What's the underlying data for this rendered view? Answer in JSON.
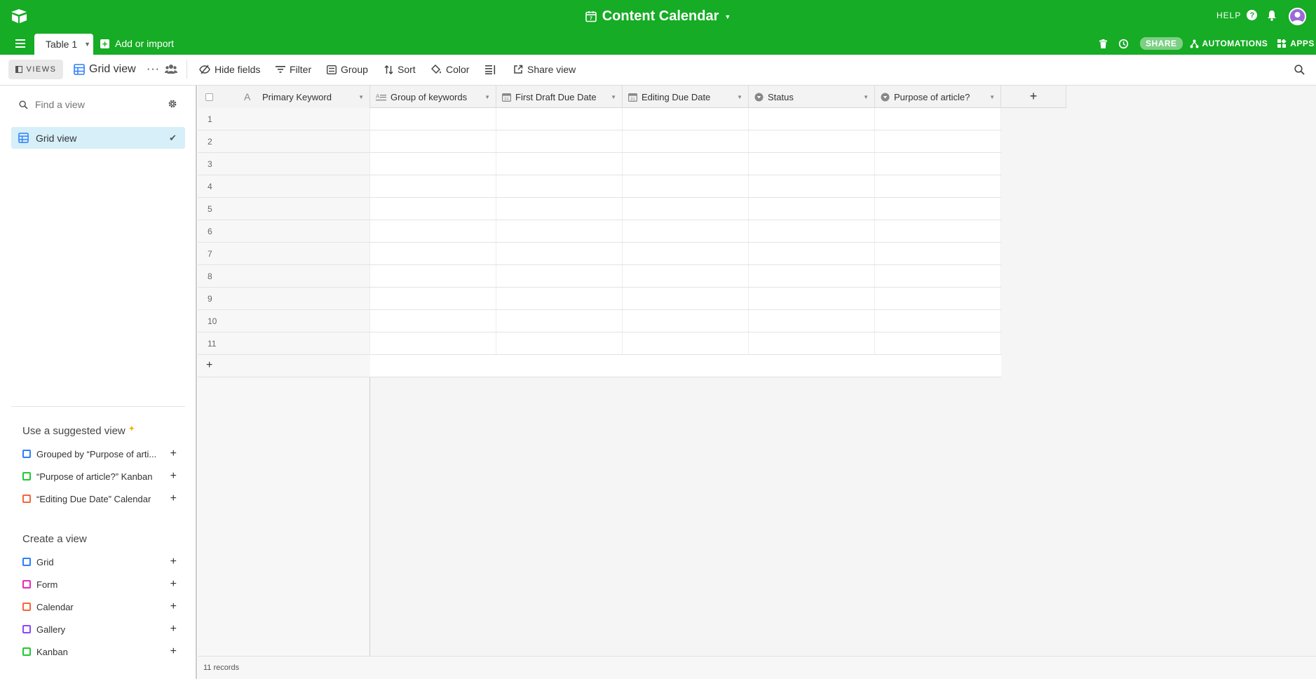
{
  "topbar": {
    "base_title": "Content Calendar",
    "help_label": "HELP",
    "table_tab": "Table 1",
    "add_import": "Add or import",
    "share": "SHARE",
    "automations": "AUTOMATIONS",
    "apps": "APPS",
    "brand_color": "#16ac25"
  },
  "toolbar": {
    "views_label": "VIEWS",
    "current_view": "Grid view",
    "hide_fields": "Hide fields",
    "filter": "Filter",
    "group": "Group",
    "sort": "Sort",
    "color": "Color",
    "share_view": "Share view"
  },
  "sidebar": {
    "find_placeholder": "Find a view",
    "selected_view": "Grid view",
    "suggested_heading": "Use a suggested view",
    "suggested": [
      {
        "label": "Grouped by “Purpose of arti...",
        "icon": "grid-icon",
        "color": "#2d7ff9"
      },
      {
        "label": "“Purpose of article?” Kanban",
        "icon": "kanban-icon",
        "color": "#20c933"
      },
      {
        "label": "“Editing Due Date” Calendar",
        "icon": "calendar-icon",
        "color": "#f7653b"
      }
    ],
    "create_heading": "Create a view",
    "create": [
      {
        "label": "Grid",
        "icon": "grid-icon",
        "color": "#2d7ff9"
      },
      {
        "label": "Form",
        "icon": "form-icon",
        "color": "#e929ba"
      },
      {
        "label": "Calendar",
        "icon": "calendar-icon",
        "color": "#f7653b"
      },
      {
        "label": "Gallery",
        "icon": "gallery-icon",
        "color": "#8b46ff"
      },
      {
        "label": "Kanban",
        "icon": "kanban-icon",
        "color": "#20c933"
      }
    ]
  },
  "grid": {
    "columns": [
      {
        "name": "Primary Keyword",
        "icon": "text-icon"
      },
      {
        "name": "Group of keywords",
        "icon": "long-text-icon"
      },
      {
        "name": "First Draft Due Date",
        "icon": "date-icon"
      },
      {
        "name": "Editing Due Date",
        "icon": "date-icon"
      },
      {
        "name": "Status",
        "icon": "single-select-icon"
      },
      {
        "name": "Purpose of article?",
        "icon": "single-select-icon"
      }
    ],
    "row_numbers": [
      "1",
      "2",
      "3",
      "4",
      "5",
      "6",
      "7",
      "8",
      "9",
      "10",
      "11"
    ],
    "add_row": "+",
    "add_column": "+",
    "record_count": "11 records"
  }
}
